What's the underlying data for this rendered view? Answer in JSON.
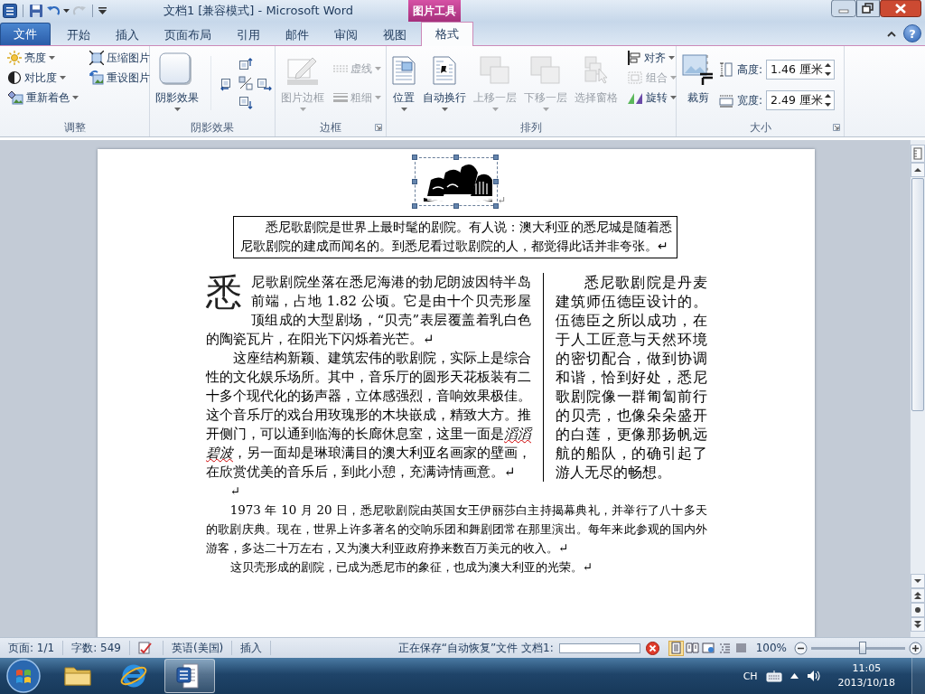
{
  "window": {
    "title": "文档1 [兼容模式] - Microsoft Word",
    "context_label": "图片工具"
  },
  "quick_access": [
    {
      "disabled": false
    },
    {
      "disabled": false
    },
    {
      "disabled": true
    }
  ],
  "tabs": [
    {
      "label": "文件",
      "kind": "file",
      "selected": false
    },
    {
      "label": "开始",
      "kind": "normal",
      "selected": false
    },
    {
      "label": "插入",
      "kind": "normal",
      "selected": false
    },
    {
      "label": "页面布局",
      "kind": "normal",
      "selected": false
    },
    {
      "label": "引用",
      "kind": "normal",
      "selected": false
    },
    {
      "label": "邮件",
      "kind": "normal",
      "selected": false
    },
    {
      "label": "审阅",
      "kind": "normal",
      "selected": false
    },
    {
      "label": "视图",
      "kind": "normal",
      "selected": false
    },
    {
      "label": "格式",
      "kind": "context",
      "selected": true
    }
  ],
  "help": "?",
  "ribbon": [
    {
      "label": "调整",
      "items": [
        {
          "kind": "stack",
          "items": [
            {
              "label": "亮度",
              "dropdown": true,
              "disabled": false
            },
            {
              "label": "对比度",
              "dropdown": true,
              "disabled": false
            },
            {
              "label": "重新着色",
              "dropdown": true,
              "disabled": false
            }
          ]
        },
        {
          "kind": "stack",
          "items": [
            {
              "label": "压缩图片",
              "dropdown": false,
              "disabled": false
            },
            {
              "label": "重设图片",
              "dropdown": false,
              "disabled": false
            }
          ]
        }
      ]
    },
    {
      "label": "阴影效果",
      "items": [
        {
          "kind": "large",
          "label": "阴影效果",
          "dropdown": true,
          "disabled": false
        },
        {
          "kind": "nudge"
        }
      ]
    },
    {
      "label": "边框",
      "launcher": true,
      "items": [
        {
          "kind": "large",
          "label": "图片边框",
          "dropdown": true,
          "disabled": true
        },
        {
          "kind": "stack",
          "items": [
            {
              "label": "虚线",
              "dropdown": true,
              "disabled": true
            },
            {
              "label": "粗细",
              "dropdown": true,
              "disabled": true
            }
          ]
        }
      ]
    },
    {
      "label": "排列",
      "items": [
        {
          "kind": "large",
          "label": "位置",
          "dropdown": true,
          "disabled": false
        },
        {
          "kind": "large",
          "label": "自动换行",
          "dropdown": true,
          "disabled": false
        },
        {
          "kind": "large",
          "label": "上移一层",
          "dropdown": true,
          "disabled": true
        },
        {
          "kind": "large",
          "label": "下移一层",
          "dropdown": true,
          "disabled": true
        },
        {
          "kind": "large",
          "label": "选择窗格",
          "dropdown": false,
          "disabled": true
        },
        {
          "kind": "stack",
          "items": [
            {
              "label": "对齐",
              "dropdown": true,
              "disabled": false
            },
            {
              "label": "组合",
              "dropdown": true,
              "disabled": true
            },
            {
              "label": "旋转",
              "dropdown": true,
              "disabled": false
            }
          ]
        }
      ]
    },
    {
      "label": "大小",
      "launcher": true,
      "items": [
        {
          "kind": "large",
          "label": "裁剪",
          "dropdown": false,
          "disabled": false
        },
        {
          "kind": "spinners",
          "fields": [
            {
              "label": "高度:",
              "value": "1.46 厘米"
            },
            {
              "label": "宽度:",
              "value": "2.49 厘米"
            }
          ]
        }
      ]
    }
  ],
  "document": {
    "picture": {
      "selected": true,
      "end_mark": "↵"
    },
    "boxed_paragraph": "悉尼歌剧院是世界上最时髦的剧院。有人说：澳大利亚的悉尼城是随着悉尼歌剧院的建成而闻名的。到悉尼看过歌剧院的人，都觉得此话并非夸张。↵",
    "left_column": [
      {
        "drop_cap": "悉",
        "text": "尼歌剧院坐落在悉尼海港的勃尼朗波因特半岛前端，占地 1.82 公顷。它是由十个贝壳形屋顶组成的大型剧场，“贝壳”表层覆盖着乳白色的陶瓷瓦片，在阳光下闪烁着光芒。↵"
      },
      {
        "text": [
          {
            "text": "这座结构新颖、建筑宏伟的歌剧院，实际上是综合性的文化娱乐场所。其中，音乐厅的圆形天花板装有二十多个现代化的扬声器，立体感强烈，音响效果极佳。这个音乐厅的戏台用玫瑰形的木块嵌成，精致大方。推开侧门，可以通到临海的长廊休息室，这里一面是",
            "italic": false
          },
          {
            "text": "滔滔碧波",
            "italic": true
          },
          {
            "text": "，另一面却是琳琅满目的澳大利亚名画家的壁画，在欣赏优美的音乐后，到此小憩，充满诗情画意。↵",
            "italic": false
          }
        ]
      }
    ],
    "right_column": [
      {
        "text": "悉尼歌剧院是丹麦建筑师伍德臣设计的。伍德臣之所以成功，在于人工匠意与天然环境的密切配合，做到协调和谐，恰到好处，悉尼歌剧院像一群匍匐前行的贝壳，也像朵朵盛开的白莲，更像那扬帆远航的船队，的确引起了游人无尽的畅想。"
      }
    ],
    "paragraphs": [
      "↵",
      "1973 年 10 月 20 日，悉尼歌剧院由英国女王伊丽莎白主持揭幕典礼，并举行了八十多天的歌剧庆典。现在，世界上许多著名的交响乐团和舞剧团常在那里演出。每年来此参观的国内外游客，多达二十万左右，又为澳大利亚政府挣来数百万美元的收入。↵",
      "这贝壳形成的剧院，已成为悉尼市的象征，也成为澳大利亚的光荣。↵"
    ]
  },
  "status_bar": {
    "page": "页面: 1/1",
    "words": "字数: 549",
    "language": "英语(美国)",
    "mode": "插入",
    "saving": "正在保存“自动恢复”文件 文档1:",
    "progress": {
      "level": 0
    },
    "views": [
      {
        "selected": true
      },
      {
        "selected": false
      },
      {
        "selected": false
      },
      {
        "selected": false
      },
      {
        "selected": false
      }
    ],
    "zoom": "100%",
    "zoom_slider": {
      "level": 0.55
    }
  },
  "taskbar": {
    "apps": [
      {
        "selected": false
      },
      {
        "selected": false
      },
      {
        "selected": true
      }
    ],
    "ime": "CH",
    "time": "11:05",
    "date": "2013/10/18"
  }
}
